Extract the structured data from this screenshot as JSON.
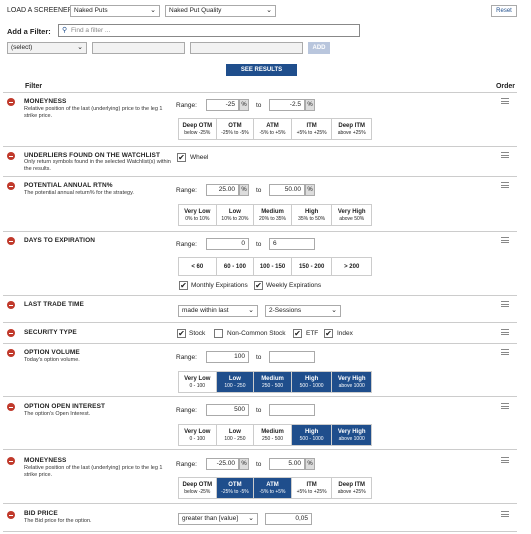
{
  "screener": {
    "load_label": "LOAD A SCREENER:",
    "select1": "Naked Puts",
    "select2": "Naked Put Quality",
    "reset": "Reset",
    "add_filter_label": "Add a Filter:",
    "search_placeholder": "Find a filter ...",
    "filter_select": "(select)",
    "add_button": "ADD",
    "see_results": "SEE RESULTS"
  },
  "table_header": {
    "filter": "Filter",
    "order": "Order"
  },
  "range_label": "Range:",
  "to_label": "to",
  "pct_symbol": "%",
  "filters": {
    "moneyness1": {
      "title": "MONEYNESS",
      "desc": "Relative position of the last (underlying) price to the leg 1 strike price.",
      "from": "-25",
      "to": "-2.5",
      "cells": [
        {
          "name": "Deep OTM",
          "range": "below -25%"
        },
        {
          "name": "OTM",
          "range": "-25% to -5%"
        },
        {
          "name": "ATM",
          "range": "-5% to +5%"
        },
        {
          "name": "ITM",
          "range": "+5% to +25%"
        },
        {
          "name": "Deep ITM",
          "range": "above +25%"
        }
      ]
    },
    "watchlist": {
      "title": "UNDERLIERS FOUND ON THE WATCHLIST",
      "desc": "Only return symbols found in the selected Watchlist(s) within the results.",
      "option": "Wheel"
    },
    "annual_rtn": {
      "title": "POTENTIAL ANNUAL RTN%",
      "desc": "The potential annual return% for the strategy.",
      "from": "25.00",
      "to": "50.00",
      "cells": [
        {
          "name": "Very Low",
          "range": "0% to 10%"
        },
        {
          "name": "Low",
          "range": "10% to 20%"
        },
        {
          "name": "Medium",
          "range": "20% to 35%"
        },
        {
          "name": "High",
          "range": "35% to 50%"
        },
        {
          "name": "Very High",
          "range": "above 50%"
        }
      ]
    },
    "dte": {
      "title": "DAYS TO EXPIRATION",
      "from": "0",
      "to": "6",
      "cells": [
        "< 60",
        "60 - 100",
        "100 - 150",
        "150 - 200",
        "> 200"
      ],
      "monthly": "Monthly Expirations",
      "weekly": "Weekly Expirations"
    },
    "last_trade": {
      "title": "LAST TRADE TIME",
      "sel1": "made within last",
      "sel2": "2-Sessions"
    },
    "security": {
      "title": "SECURITY TYPE",
      "options": [
        "Stock",
        "Non-Common Stock",
        "ETF",
        "Index"
      ]
    },
    "volume": {
      "title": "OPTION VOLUME",
      "desc": "Today's option volume.",
      "from": "100",
      "to": "",
      "cells": [
        {
          "name": "Very Low",
          "range": "0 - 100"
        },
        {
          "name": "Low",
          "range": "100 - 250"
        },
        {
          "name": "Medium",
          "range": "250 - 500"
        },
        {
          "name": "High",
          "range": "500 - 1000"
        },
        {
          "name": "Very High",
          "range": "above 1000"
        }
      ]
    },
    "open_interest": {
      "title": "OPTION OPEN INTEREST",
      "desc": "The option's Open Interest.",
      "from": "500",
      "to": "",
      "cells": [
        {
          "name": "Very Low",
          "range": "0 - 100"
        },
        {
          "name": "Low",
          "range": "100 - 250"
        },
        {
          "name": "Medium",
          "range": "250 - 500"
        },
        {
          "name": "High",
          "range": "500 - 1000"
        },
        {
          "name": "Very High",
          "range": "above 1000"
        }
      ]
    },
    "moneyness2": {
      "title": "MONEYNESS",
      "desc": "Relative position of the last (underlying) price to the leg 1 strike price.",
      "from": "-25.00",
      "to": "5.00",
      "cells": [
        {
          "name": "Deep OTM",
          "range": "below -25%"
        },
        {
          "name": "OTM",
          "range": "-25% to -5%"
        },
        {
          "name": "ATM",
          "range": "-5% to +5%"
        },
        {
          "name": "ITM",
          "range": "+5% to +25%"
        },
        {
          "name": "Deep ITM",
          "range": "above +25%"
        }
      ]
    },
    "bid": {
      "title": "BID PRICE",
      "desc": "The Bid price for the option.",
      "sel": "greater than [value]",
      "value": "0,05"
    }
  },
  "colors": {
    "accent": "#1f4e8c",
    "remove": "#c0392b"
  }
}
